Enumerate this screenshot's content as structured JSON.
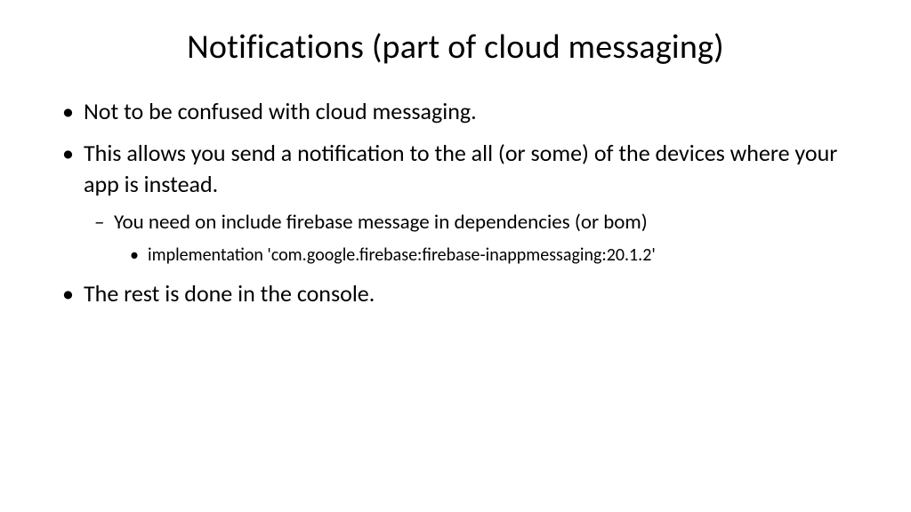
{
  "title": "Notifications (part of cloud messaging)",
  "bullets": {
    "item1": "Not to be confused with cloud messaging.",
    "item2": "This allows you send a notification to the all (or some) of the devices where your app is instead.",
    "item2_sub1": "You need on include firebase message in dependencies (or bom)",
    "item2_sub1_sub1": "implementation 'com.google.firebase:firebase-inappmessaging:20.1.2'",
    "item3": "The rest is done in the console."
  }
}
